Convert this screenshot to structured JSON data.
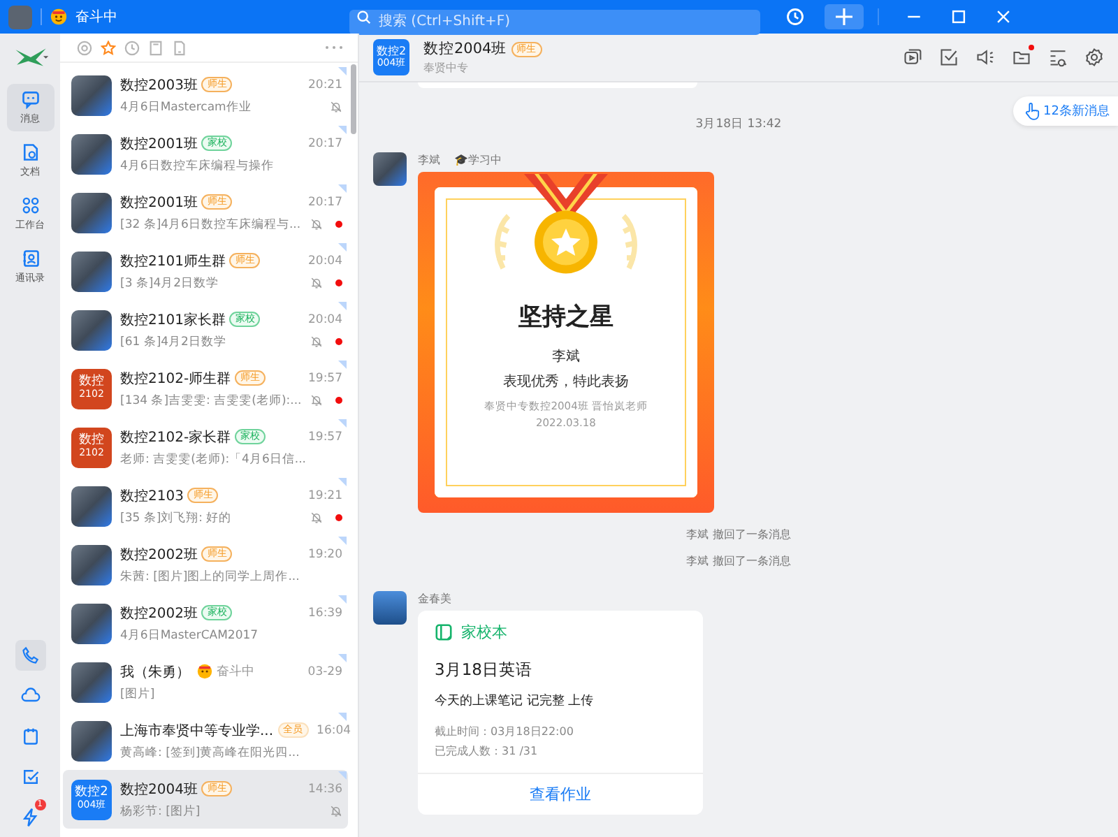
{
  "topbar": {
    "status": "奋斗中",
    "search": {
      "placeholder": "搜索 (Ctrl+Shift+F)"
    }
  },
  "rail": {
    "items": [
      {
        "label": "消息",
        "selected": true
      },
      {
        "label": "文档",
        "selected": false
      },
      {
        "label": "工作台",
        "selected": false
      },
      {
        "label": "通讯录",
        "selected": false
      }
    ],
    "bottom": [
      {
        "selected": true
      },
      {
        "selected": false
      },
      {
        "selected": false
      },
      {
        "selected": false
      },
      {
        "selected": false,
        "badge": "1"
      }
    ]
  },
  "filters": [
    {
      "selected": false
    },
    {
      "selected": true
    },
    {
      "selected": false
    },
    {
      "selected": false
    },
    {
      "selected": false
    }
  ],
  "conversations": [
    {
      "name": "数控2003班",
      "tag": {
        "label": "师生",
        "kind": "teacher"
      },
      "time": "20:21",
      "preview": "4月6日Mastercam作业",
      "muted": true,
      "unread": false,
      "selected": false,
      "avatar": {
        "kind": "photo"
      }
    },
    {
      "name": "数控2001班",
      "tag": {
        "label": "家校",
        "kind": "family"
      },
      "time": "20:17",
      "preview": "4月6日数控车床编程与操作",
      "muted": false,
      "unread": false,
      "selected": false,
      "avatar": {
        "kind": "photo"
      }
    },
    {
      "name": "数控2001班",
      "tag": {
        "label": "师生",
        "kind": "teacher"
      },
      "time": "20:17",
      "preview": "[32 条]4月6日数控车床编程与...",
      "muted": true,
      "unread": true,
      "selected": false,
      "avatar": {
        "kind": "photo"
      }
    },
    {
      "name": "数控2101师生群",
      "tag": {
        "label": "师生",
        "kind": "teacher"
      },
      "time": "20:04",
      "preview": "[3 条]4月2日数学",
      "muted": true,
      "unread": true,
      "selected": false,
      "avatar": {
        "kind": "photo"
      }
    },
    {
      "name": "数控2101家长群",
      "tag": {
        "label": "家校",
        "kind": "family"
      },
      "time": "20:04",
      "preview": "[61 条]4月2日数学",
      "muted": true,
      "unread": true,
      "selected": false,
      "avatar": {
        "kind": "photo"
      }
    },
    {
      "name": "数控2102-师生群",
      "tag": {
        "label": "师生",
        "kind": "teacher"
      },
      "time": "19:57",
      "preview": "[134 条]吉雯雯: 吉雯雯(老师):...",
      "muted": true,
      "unread": true,
      "selected": false,
      "avatar": {
        "kind": "text",
        "line1": "数控",
        "line2": "2102",
        "color": "#d2461e"
      }
    },
    {
      "name": "数控2102-家长群",
      "tag": {
        "label": "家校",
        "kind": "family"
      },
      "time": "19:57",
      "preview": "老师: 吉雯雯(老师):「4月6日信...",
      "muted": false,
      "unread": false,
      "selected": false,
      "avatar": {
        "kind": "text",
        "line1": "数控",
        "line2": "2102",
        "color": "#d2461e"
      }
    },
    {
      "name": "数控2103",
      "tag": {
        "label": "师生",
        "kind": "teacher"
      },
      "time": "19:21",
      "preview": "[35 条]刘飞翔: 好的",
      "muted": true,
      "unread": true,
      "selected": false,
      "avatar": {
        "kind": "photo"
      }
    },
    {
      "name": "数控2002班",
      "tag": {
        "label": "师生",
        "kind": "teacher"
      },
      "time": "19:20",
      "preview": "朱茜: [图片]图上的同学上周作...",
      "muted": false,
      "unread": false,
      "selected": false,
      "avatar": {
        "kind": "photo"
      }
    },
    {
      "name": "数控2002班",
      "tag": {
        "label": "家校",
        "kind": "family"
      },
      "time": "16:39",
      "preview": "4月6日MasterCAM2017",
      "muted": false,
      "unread": false,
      "selected": false,
      "avatar": {
        "kind": "photo"
      }
    },
    {
      "name": "我（朱勇）",
      "status": "奋斗中",
      "time": "03-29",
      "preview": "[图片]",
      "muted": false,
      "unread": false,
      "selected": false,
      "avatar": {
        "kind": "photo"
      }
    },
    {
      "name": "上海市奉贤中等专业学...",
      "tag": {
        "label": "全员",
        "kind": "all"
      },
      "time": "16:04",
      "preview": "黄高峰: [签到]黄高峰在阳光四...",
      "muted": false,
      "unread": false,
      "selected": false,
      "avatar": {
        "kind": "photo"
      }
    },
    {
      "name": "数控2004班",
      "tag": {
        "label": "师生",
        "kind": "teacher"
      },
      "time": "14:36",
      "preview": "杨彩节: [图片]",
      "muted": true,
      "unread": false,
      "selected": true,
      "avatar": {
        "kind": "text",
        "line1": "数控2",
        "line2": "004班",
        "color": "#1a7cf5"
      }
    }
  ],
  "chat": {
    "title": "数控2004班",
    "tag": {
      "label": "师生",
      "kind": "teacher"
    },
    "subtitle": "奉贤中专",
    "avatar": {
      "line1": "数控2",
      "line2": "004班"
    },
    "tools": [
      {
        "dot": false
      },
      {
        "dot": false
      },
      {
        "dot": false
      },
      {
        "dot": true
      },
      {
        "dot": false
      },
      {
        "dot": false
      }
    ],
    "new_messages": "12条新消息",
    "date": "3月18日 13:42",
    "award": {
      "sender": "李斌",
      "status": "🎓学习中",
      "title": "坚持之星",
      "name": "李斌",
      "text": "表现优秀，特此表扬",
      "footer": "奉贤中专数控2004班 晋怡岚老师",
      "date": "2022.03.18"
    },
    "notices": [
      "李斌 撤回了一条消息",
      "李斌 撤回了一条消息"
    ],
    "homework": {
      "sender": "金春美",
      "app": "家校本",
      "title": "3月18日英语",
      "body": "今天的上课笔记 记完整 上传",
      "deadline": "截止时间：03月18日22:00",
      "done": "已完成人数：31 /31",
      "action": "查看作业"
    }
  }
}
